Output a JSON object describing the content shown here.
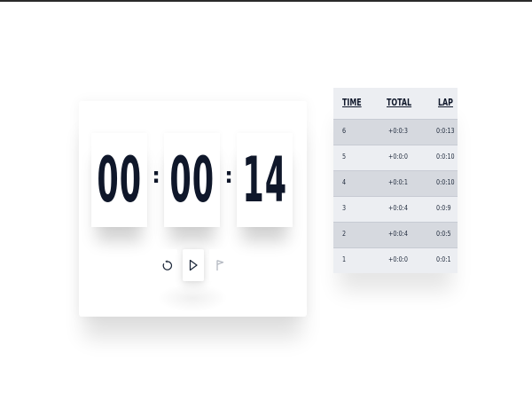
{
  "timer": {
    "hours": "00",
    "minutes": "00",
    "seconds": "14",
    "separator": ":"
  },
  "controls": {
    "reset_icon": "reset-icon",
    "play_icon": "play-icon",
    "lap_icon": "flag-icon"
  },
  "laps": {
    "headers": {
      "time": "TIME",
      "total": "TOTAL",
      "lap": "LAP"
    },
    "rows": [
      {
        "time": "6",
        "total": "+0:0:3",
        "lap": "0:0:13"
      },
      {
        "time": "5",
        "total": "+0:0:0",
        "lap": "0:0:10"
      },
      {
        "time": "4",
        "total": "+0:0:1",
        "lap": "0:0:10"
      },
      {
        "time": "3",
        "total": "+0:0:4",
        "lap": "0:0:9"
      },
      {
        "time": "2",
        "total": "+0:0:4",
        "lap": "0:0:5"
      },
      {
        "time": "1",
        "total": "+0:0:0",
        "lap": "0:0:1"
      }
    ]
  },
  "colors": {
    "digit": "#0f172a",
    "table_bg": "#e9ebef",
    "row_alt": "#d6d9df"
  }
}
